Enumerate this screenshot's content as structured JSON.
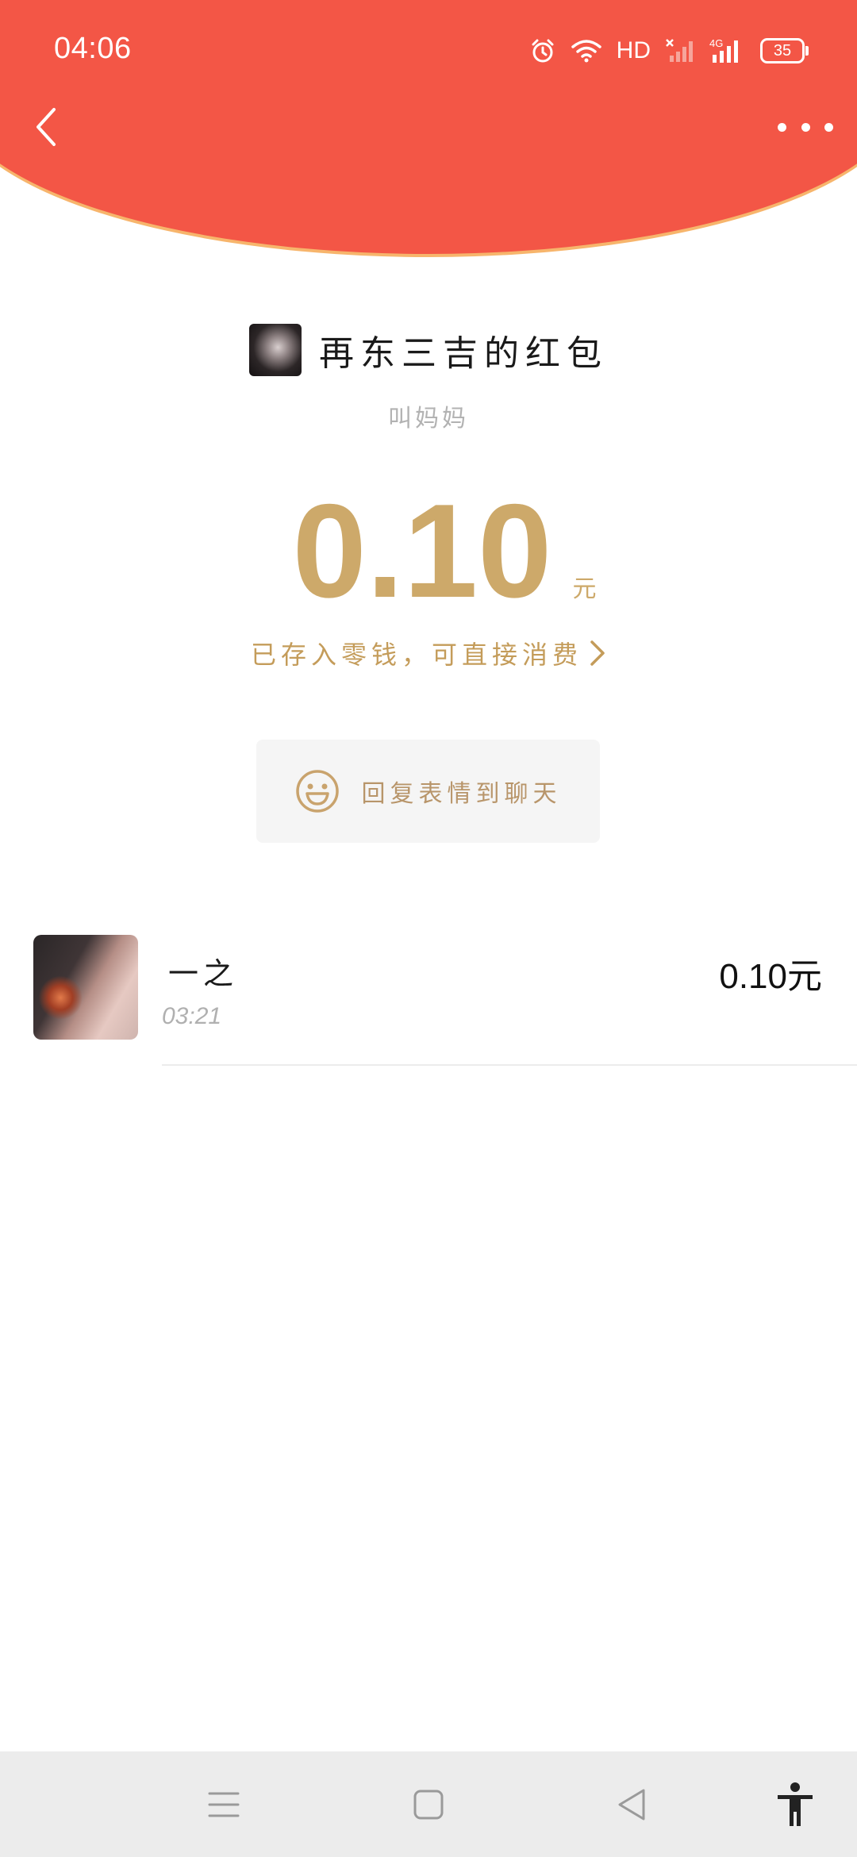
{
  "status_bar": {
    "time": "04:06",
    "network_label": "HD",
    "battery": "35",
    "icons": [
      "alarm-icon",
      "wifi-icon",
      "hd-icon",
      "signal-icon",
      "4g-signal-icon",
      "battery-icon"
    ]
  },
  "header": {
    "back_icon": "chevron-left-icon",
    "more_icon": "more-dots-icon"
  },
  "red_packet": {
    "sender_title": "再东三吉的红包",
    "greeting": "叫妈妈",
    "amount": "0.10",
    "unit": "元",
    "stored_text": "已存入零钱，可直接消费",
    "reply_label": "回复表情到聊天"
  },
  "receivers": [
    {
      "name": "一之",
      "time": "03:21",
      "amount": "0.10元"
    }
  ],
  "nav_bar": {
    "icons": [
      "menu-icon",
      "home-square-icon",
      "back-triangle-icon",
      "accessibility-icon"
    ]
  },
  "colors": {
    "header_red": "#f35646",
    "gold": "#cda96a",
    "nav_bg": "#ececec"
  }
}
